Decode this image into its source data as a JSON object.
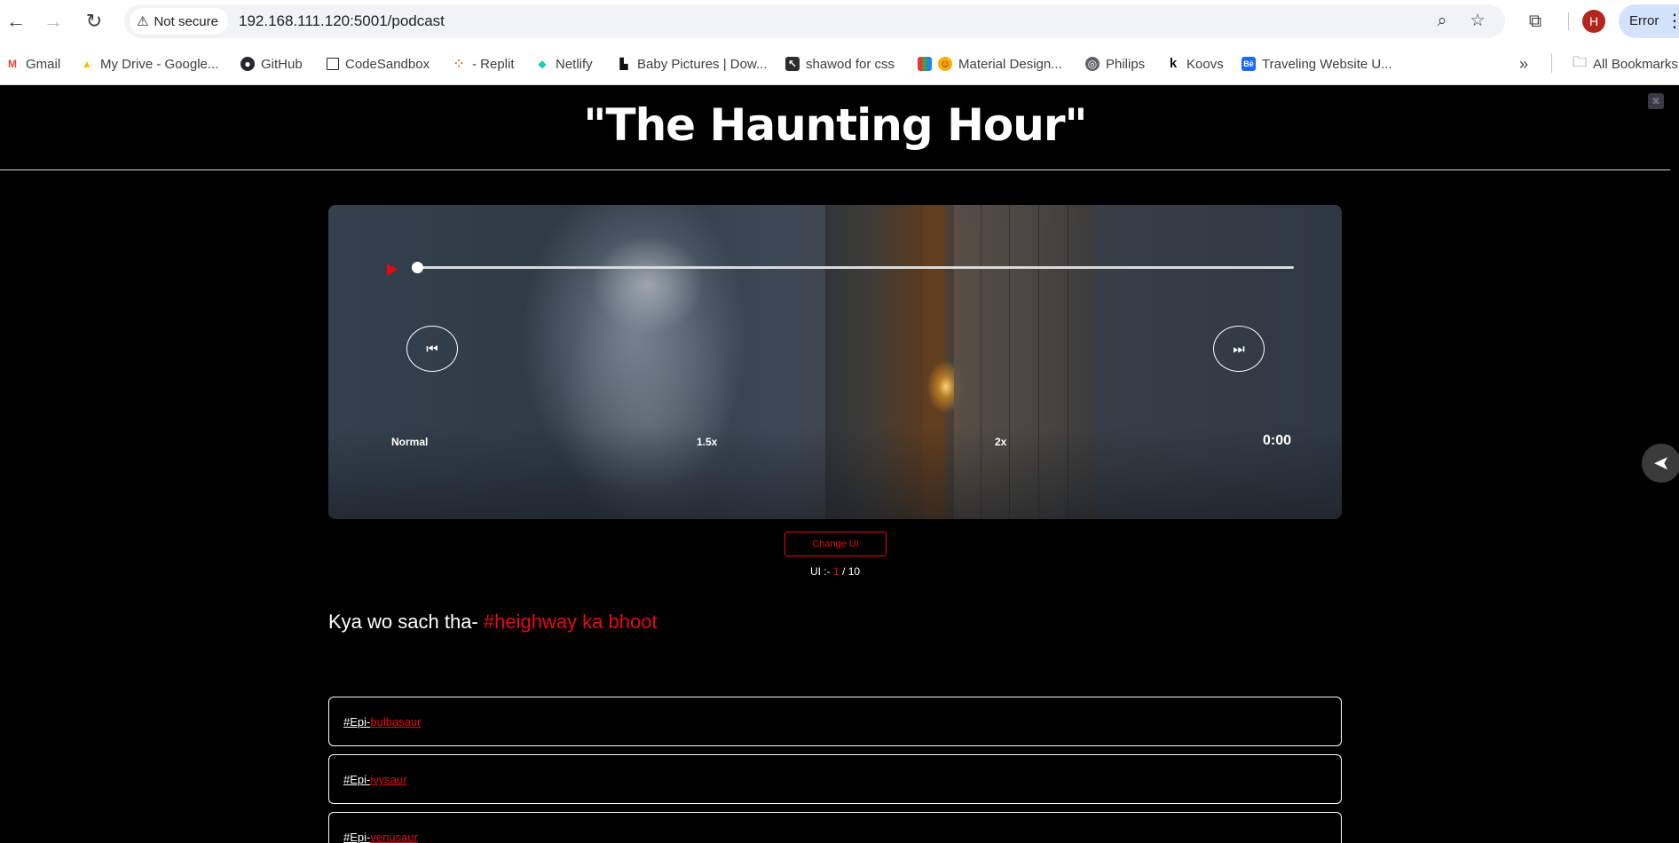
{
  "browser": {
    "security_label": "Not secure",
    "url": "192.168.111.120:5001/podcast",
    "profile_initial": "H",
    "error_label": "Error"
  },
  "bookmarks": [
    {
      "label": "Gmail",
      "icon": "gmail-icon",
      "color": "#ea4335",
      "glyph": "M"
    },
    {
      "label": "My Drive - Google...",
      "icon": "google-drive-icon",
      "color": "#fbbc04",
      "glyph": "▲"
    },
    {
      "label": "GitHub",
      "icon": "github-icon",
      "color": "#24292f",
      "glyph": "●"
    },
    {
      "label": "CodeSandbox",
      "icon": "codesandbox-icon",
      "color": "#ffffff",
      "glyph": "□"
    },
    {
      "label": "- Replit",
      "icon": "replit-icon",
      "color": "#f26207",
      "glyph": "⁘"
    },
    {
      "label": "Netlify",
      "icon": "netlify-icon",
      "color": "#20c6b7",
      "glyph": "◆"
    },
    {
      "label": "Baby Pictures | Dow...",
      "icon": "unsplash-icon",
      "color": "#111111",
      "glyph": "▙"
    },
    {
      "label": "shawod for css",
      "icon": "cursor-icon",
      "color": "#2d2d2d",
      "glyph": "↖"
    },
    {
      "label": "Material Design...",
      "icon": "material-design-icon",
      "color": "#e8710a",
      "glyph": "▦"
    },
    {
      "label": "Philips",
      "icon": "globe-icon",
      "color": "#5f6368",
      "glyph": "◎"
    },
    {
      "label": "Koovs",
      "icon": "koovs-icon",
      "color": "#ffffff",
      "glyph": "k"
    },
    {
      "label": "Traveling Website U...",
      "icon": "behance-icon",
      "color": "#1769ff",
      "glyph": "Bē"
    }
  ],
  "all_bookmarks_label": "All Bookmarks",
  "page": {
    "title": "\"The Haunting Hour\"",
    "player": {
      "progress_fraction": 0,
      "speeds": [
        "Normal",
        "1.5x",
        "2x"
      ],
      "time": "0:00"
    },
    "change_ui_label": "Change UI",
    "ui_counter": {
      "prefix": "UI :-",
      "current": "1",
      "separator": "/",
      "total": "10"
    },
    "episode_heading": {
      "text": "Kya wo sach tha-",
      "tag": "#heighway ka bhoot"
    },
    "episodes": [
      {
        "prefix": "#Epi-",
        "name": "bulbasaur"
      },
      {
        "prefix": "#Epi-",
        "name": "ivysaur"
      },
      {
        "prefix": "#Epi-",
        "name": "venusaur"
      }
    ]
  },
  "colors": {
    "accent": "#e50914",
    "background": "#000000"
  }
}
